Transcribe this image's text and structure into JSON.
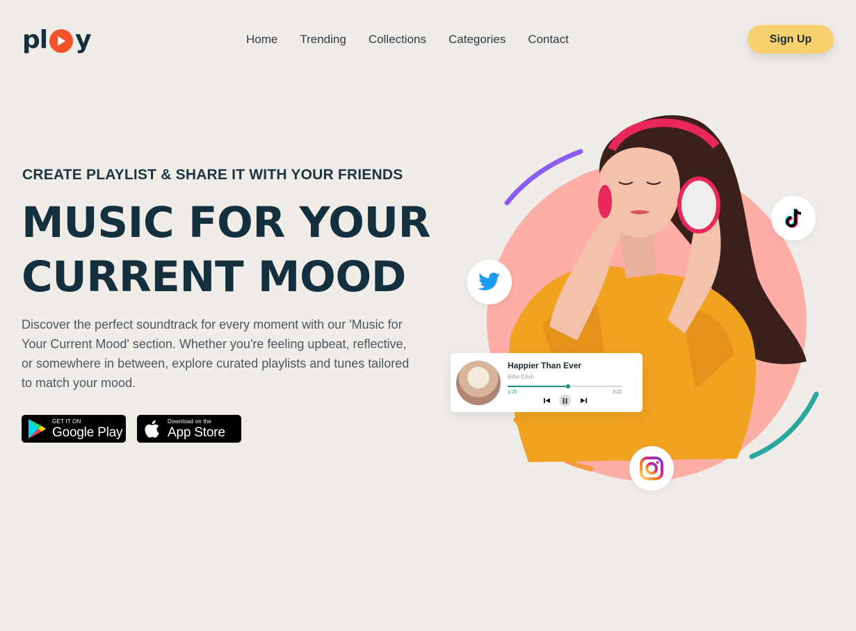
{
  "brand": {
    "logo_left": "pl",
    "logo_right": "y",
    "accent": "#f2532a",
    "dark": "#142f3e",
    "signup_color": "#f8d16e"
  },
  "nav": {
    "items": [
      {
        "label": "Home"
      },
      {
        "label": "Trending"
      },
      {
        "label": "Collections"
      },
      {
        "label": "Categories"
      },
      {
        "label": "Contact"
      }
    ],
    "signup_label": "Sign Up"
  },
  "hero": {
    "eyebrow": "CREATE PLAYLIST & SHARE IT WITH YOUR FRIENDS",
    "headline_line1": "MUSIC FOR YOUR",
    "headline_line2": "CURRENT MOOD",
    "description": "Discover the perfect soundtrack for every moment with our 'Music for Your Current Mood' section. Whether you're feeling upbeat, reflective, or somewhere in between, explore curated playlists and tunes tailored to match your mood."
  },
  "store_badges": {
    "google_play": {
      "small": "GET IT ON",
      "big": "Google Play"
    },
    "app_store": {
      "small": "Download on the",
      "big": "App Store"
    }
  },
  "player": {
    "song_title": "Happier Than Ever",
    "artist": "Billie Eilish",
    "current_time": "1:25",
    "total_time": "3:21",
    "progress": 0.53,
    "accent": "#1f8c86"
  },
  "social": {
    "icons": [
      "twitter-icon",
      "tiktok-icon",
      "instagram-icon"
    ]
  },
  "decor_colors": {
    "circle": "#fdaea7",
    "arc_purple": "#8d5cf2",
    "arc_orange": "#f69a3e",
    "arc_teal": "#2aa7a0"
  }
}
